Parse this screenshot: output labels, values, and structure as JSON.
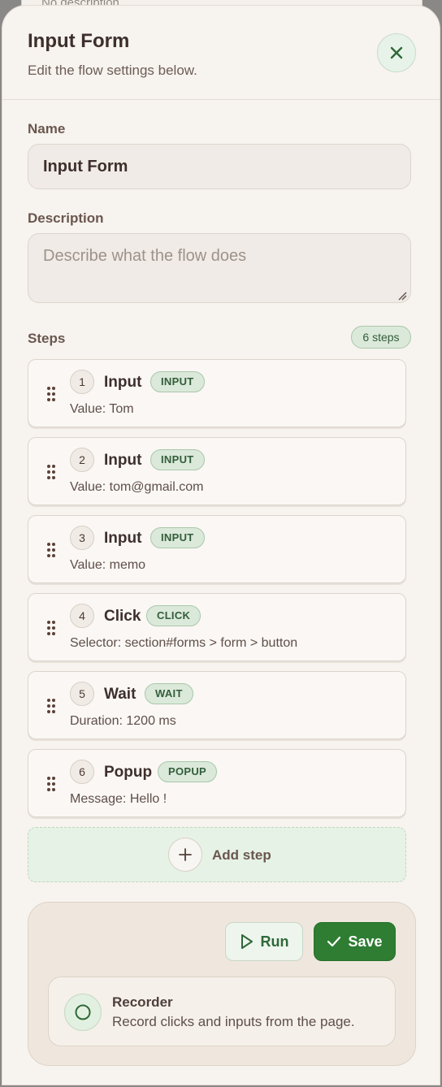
{
  "backdrop": {
    "text": "No description"
  },
  "dialog": {
    "title": "Input Form",
    "subtitle": "Edit the flow settings below."
  },
  "form": {
    "name_label": "Name",
    "name_value": "Input Form",
    "description_label": "Description",
    "description_placeholder": "Describe what the flow does"
  },
  "steps": {
    "label": "Steps",
    "count_text": "6 steps",
    "items": [
      {
        "number": "1",
        "title": "Input",
        "badge": "INPUT",
        "detail": "Value: Tom"
      },
      {
        "number": "2",
        "title": "Input",
        "badge": "INPUT",
        "detail": "Value: tom@gmail.com"
      },
      {
        "number": "3",
        "title": "Input",
        "badge": "INPUT",
        "detail": "Value: memo"
      },
      {
        "number": "4",
        "title": "Click",
        "badge": "CLICK",
        "detail": "Selector: section#forms > form > button"
      },
      {
        "number": "5",
        "title": "Wait",
        "badge": "WAIT",
        "detail": "Duration: 1200 ms"
      },
      {
        "number": "6",
        "title": "Popup",
        "badge": "POPUP",
        "detail": "Message: Hello !"
      }
    ],
    "add_label": "Add step"
  },
  "actions": {
    "run_label": "Run",
    "save_label": "Save"
  },
  "recorder": {
    "title": "Recorder",
    "description": "Record clicks and inputs from the page."
  },
  "icons": {
    "close": "close-icon",
    "drag": "drag-handle-icon",
    "plus": "plus-icon",
    "play": "play-icon",
    "check": "check-icon",
    "record": "record-icon"
  },
  "colors": {
    "accent": "#2e7d32",
    "badge_bg": "#dbe9da",
    "panel_bg": "#f7f3ee"
  }
}
